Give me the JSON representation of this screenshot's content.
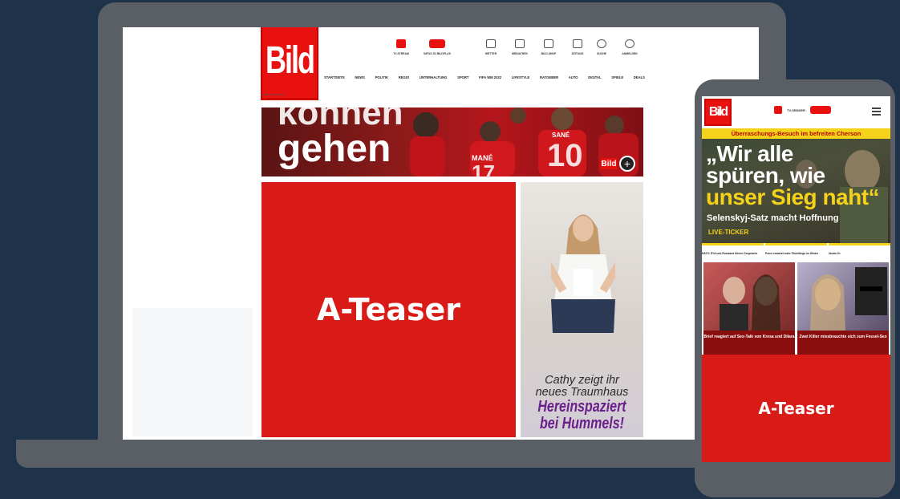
{
  "desktop": {
    "logo": "Bild",
    "top_icons": [
      {
        "label": "TV-STREAM",
        "icon": "tv-icon"
      },
      {
        "label": "INFOS ZU BILDPLUS",
        "icon": "bildplus-icon"
      },
      {
        "label": "WETTER",
        "icon": "weather-icon"
      },
      {
        "label": "MEDIATHEK",
        "icon": "video-icon"
      },
      {
        "label": "BILD-SHOP",
        "icon": "cart-icon"
      },
      {
        "label": "ZEITUNG",
        "icon": "newspaper-icon"
      },
      {
        "label": "SUCHE",
        "icon": "search-icon"
      },
      {
        "label": "ANMELDEN",
        "icon": "user-icon"
      }
    ],
    "nav": [
      "STARTSEITE",
      "NEWS",
      "POLITIK",
      "REGIO",
      "UNTERHALTUNG",
      "SPORT",
      "FIFA WM 2022",
      "LIFESTYLE",
      "RATGEBER",
      "AUTO",
      "DIGITAL",
      "SPIELE",
      "DEALS"
    ],
    "sub_label": "Aktuelle Nachrichten",
    "hero": {
      "line1": "können",
      "line2": "gehen",
      "player_names": [
        "MANÉ",
        "SANÉ",
        "10",
        "17"
      ],
      "badge": "Bild"
    },
    "a_teaser": "A-Teaser",
    "side_teaser": {
      "caption1": "Cathy zeigt ihr",
      "caption2": "neues Traumhaus",
      "headline1": "Hereinspaziert",
      "headline2": "bei Hummels!"
    }
  },
  "mobile": {
    "logo": "Bild",
    "top_label": "TV-SENDER",
    "kicker": "Überraschungs-Besuch im befreiten Cherson",
    "headline": [
      "„Wir alle",
      "spüren, wie",
      "unser Sieg naht“"
    ],
    "dek": "Selenskyj-Satz macht Hoffnung",
    "live": "LIVE-TICKER",
    "ticker": [
      "NATO: EVA und Russland führen Gespräche",
      "Polen erwartet mehr Flüchtlinge im Winter",
      "Ukrain Kr"
    ],
    "cards": [
      {
        "caption": "Brief reagiert auf Sex-Talk von Kresa und Dilara"
      },
      {
        "caption": "Zwei Killer missbrauchte sich zum Fessel-Sex"
      }
    ],
    "a_teaser": "A-Teaser"
  },
  "colors": {
    "background": "#1e3249",
    "device": "#5a5f66",
    "bild_red": "#e8110f",
    "teaser_red": "#d81b17",
    "accent_yellow": "#f5d21a"
  }
}
